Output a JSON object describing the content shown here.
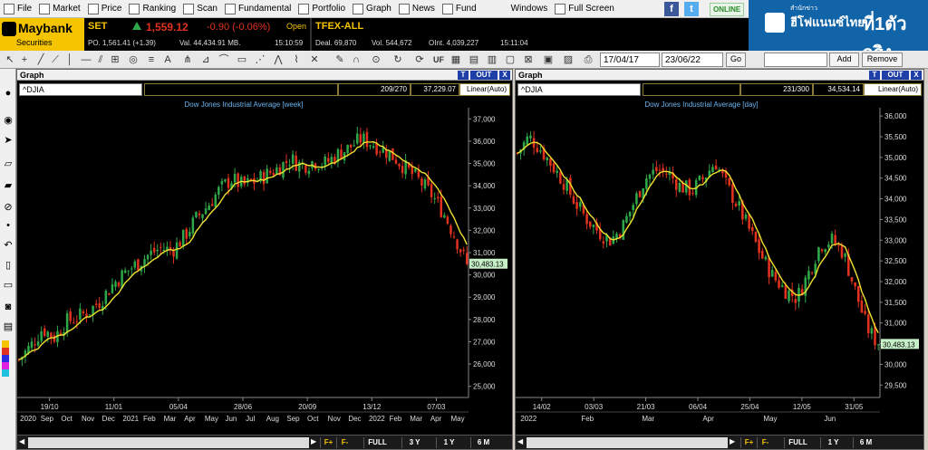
{
  "menu": {
    "items": [
      {
        "label": "File",
        "icon": "file-icon"
      },
      {
        "label": "Market",
        "icon": "market-icon"
      },
      {
        "label": "Price",
        "icon": "price-icon"
      },
      {
        "label": "Ranking",
        "icon": "ranking-icon"
      },
      {
        "label": "Scan",
        "icon": "scan-icon"
      },
      {
        "label": "Fundamental",
        "icon": "fundamental-icon"
      },
      {
        "label": "Portfolio",
        "icon": "portfolio-icon"
      },
      {
        "label": "Graph",
        "icon": "graph-icon"
      },
      {
        "label": "News",
        "icon": "news-icon"
      },
      {
        "label": "Fund",
        "icon": "fund-icon"
      },
      {
        "label": "Windows",
        "icon": ""
      },
      {
        "label": "Full Screen",
        "icon": "fullscreen-icon"
      }
    ],
    "online": "ONLINE"
  },
  "brand": {
    "name": "Maybank",
    "sub": "Securities"
  },
  "set": {
    "name": "SET",
    "value": "1,559.12",
    "change": "-0.90 (-0.06%)",
    "status": "Open",
    "po": "PO. 1,561.41 (+1.39)",
    "val": "Val. 44,434.91 MB.",
    "time": "15:10:59"
  },
  "tfex": {
    "name": "TFEX-ALL",
    "deal": "Deal. 69,870",
    "vol": "Vol. 544,672",
    "oint": "OInt. 4,039,227",
    "time": "15:11:04"
  },
  "ad": {
    "t1": "ฮีโฟแนนซ์ไทย",
    "t2": "ที่1ตัวจริง",
    "small": "สำนักข่าว"
  },
  "toolbar": {
    "date_from": "17/04/17",
    "date_to": "23/06/22",
    "go": "Go",
    "add": "Add",
    "remove": "Remove",
    "uf": "UF"
  },
  "colors": {
    "up": "#2fa84a",
    "down": "#e0321e",
    "ma": "#f0e030",
    "accent": "#1f3fa8"
  },
  "left_panel": {
    "header": "Graph",
    "t": "T",
    "out": "OUT",
    "x": "X",
    "symbol": "^DJIA",
    "count": "209/270",
    "last": "37,229.07",
    "scale": "Linear(Auto)",
    "title": "Dow Jones Industrial Average [week]",
    "last_price": "30,483.13",
    "footer": {
      "f_plus": "F+",
      "f_minus": "F-",
      "full": "FULL",
      "y3": "3 Y",
      "y1": "1 Y",
      "m6": "6 M"
    }
  },
  "right_panel": {
    "header": "Graph",
    "t": "T",
    "out": "OUT",
    "x": "X",
    "symbol": "^DJIA",
    "count": "231/300",
    "last": "34,534.14",
    "scale": "Linear(Auto)",
    "title": "Dow Jones Industrial Average [day]",
    "last_price": "30,483.13",
    "footer": {
      "f_plus": "F+",
      "f_minus": "F-",
      "full": "FULL",
      "y1": "1 Y",
      "m6": "6 M"
    }
  },
  "chart_data": [
    {
      "type": "candlestick",
      "title": "Dow Jones Industrial Average [week]",
      "ylim": [
        24500,
        37500
      ],
      "yticks": [
        25000,
        26000,
        27000,
        28000,
        29000,
        30000,
        31000,
        32000,
        33000,
        34000,
        35000,
        36000,
        37000
      ],
      "ytick_labels": [
        "25,000",
        "26,000",
        "27,000",
        "28,000",
        "29,000",
        "30,000",
        "31,000",
        "32,000",
        "33,000",
        "34,000",
        "35,000",
        "36,000",
        "37,000"
      ],
      "date_labels": [
        "19/10",
        "11/01",
        "05/04",
        "28/06",
        "20/09",
        "13/12",
        "07/03"
      ],
      "month_labels": [
        "2020",
        "Sep",
        "Oct",
        "Nov",
        "Dec",
        "2021",
        "Feb",
        "Mar",
        "Apr",
        "May",
        "Jun",
        "Jul",
        "Aug",
        "Sep",
        "Oct",
        "Nov",
        "Dec",
        "2022",
        "Feb",
        "Mar",
        "Apr",
        "May"
      ],
      "series": [
        {
          "name": "MA",
          "values": []
        }
      ],
      "close_path": [
        26200,
        26800,
        27600,
        27200,
        27900,
        28100,
        28400,
        28900,
        29600,
        30100,
        30500,
        30900,
        31200,
        31100,
        31700,
        32500,
        33100,
        33800,
        34300,
        34000,
        34200,
        34500,
        34800,
        35200,
        34900,
        35100,
        35000,
        35400,
        35700,
        36100,
        35900,
        35600,
        35200,
        34700,
        34200,
        33600,
        32800,
        31700,
        30483
      ]
    },
    {
      "type": "candlestick",
      "title": "Dow Jones Industrial Average [day]",
      "ylim": [
        29200,
        36200
      ],
      "yticks": [
        29500,
        30000,
        30500,
        31000,
        31500,
        32000,
        32500,
        33000,
        33500,
        34000,
        34500,
        35000,
        35500,
        36000
      ],
      "ytick_labels": [
        "29,500",
        "30,000",
        "30,500",
        "31,000",
        "31,500",
        "32,000",
        "32,500",
        "33,000",
        "33,500",
        "34,000",
        "34,500",
        "35,000",
        "35,500",
        "36,000"
      ],
      "date_labels": [
        "14/02",
        "03/03",
        "21/03",
        "06/04",
        "25/04",
        "12/05",
        "31/05"
      ],
      "month_labels": [
        "2022",
        "Feb",
        "Mar",
        "Apr",
        "May",
        "Jun"
      ],
      "series": [
        {
          "name": "MA",
          "values": []
        }
      ],
      "close_path": [
        35100,
        35500,
        35200,
        34800,
        34400,
        33900,
        33500,
        33200,
        33000,
        33300,
        33900,
        34500,
        34700,
        34600,
        34300,
        34200,
        34500,
        34900,
        34300,
        33800,
        33200,
        32600,
        32100,
        31800,
        31600,
        32200,
        32900,
        33000,
        32700,
        31800,
        30900,
        30483
      ]
    }
  ]
}
